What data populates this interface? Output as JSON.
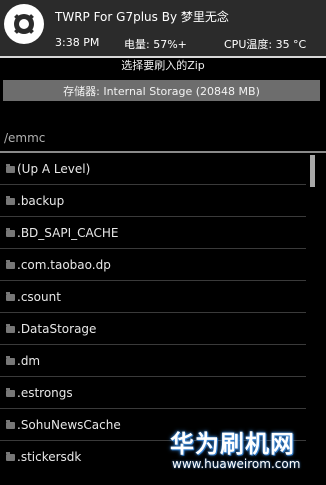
{
  "header": {
    "title": "TWRP For G7plus By 梦里无念",
    "time": "3:38 PM",
    "battery": "电量: 57%+",
    "cpu_temp": "CPU温度: 35 °C",
    "logo_icon": "twrp-logo-icon"
  },
  "instruction": "选择要刷入的Zip",
  "storage_button": "存储器: Internal Storage (20848 MB)",
  "path": "/emmc",
  "files": [
    "(Up A Level)",
    ".backup",
    ".BD_SAPI_CACHE",
    ".com.taobao.dp",
    ".csount",
    ".DataStorage",
    ".dm",
    ".estrongs",
    ".SohuNewsCache",
    ".stickersdk"
  ],
  "watermark": {
    "name": "华为刷机网",
    "url": "www.huaweirom.com"
  },
  "colors": {
    "header_bg": "#2b2b2b",
    "button_bg": "#6d6d6d",
    "watermark_glow": "#3b88d8"
  }
}
